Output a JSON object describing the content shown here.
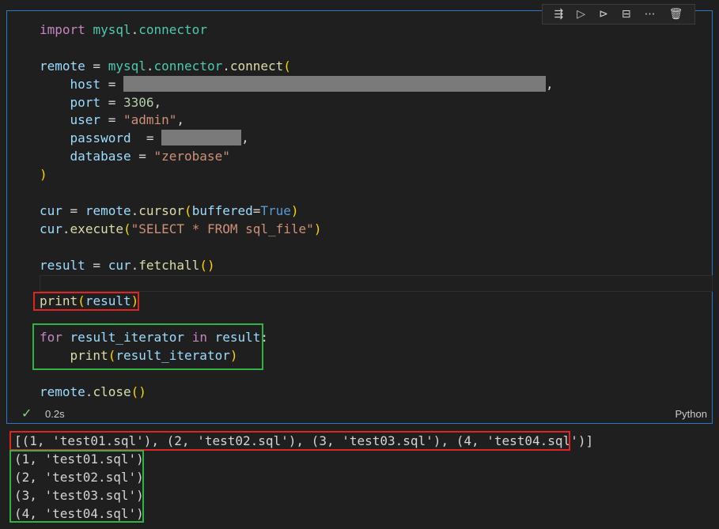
{
  "toolbar": {
    "icons": [
      "execute-above-icon",
      "run-by-line-icon",
      "execute-below-icon",
      "split-cell-icon",
      "more-icon",
      "delete-icon"
    ]
  },
  "code": {
    "l1": {
      "kw": "import",
      "mod": "mysql",
      "dot": ".",
      "sub": "connector"
    },
    "l3": {
      "var": "remote",
      "eq": " = ",
      "mod": "mysql",
      "dot": ".",
      "sub": "connector",
      "dot2": ".",
      "fn": "connect",
      "open": "("
    },
    "l4": {
      "indent": "    ",
      "key": "host",
      "eq": " = ",
      "comma": ","
    },
    "l5": {
      "indent": "    ",
      "key": "port",
      "eq": " = ",
      "val": "3306",
      "comma": ","
    },
    "l6": {
      "indent": "    ",
      "key": "user",
      "eq": " = ",
      "val": "\"admin\"",
      "comma": ","
    },
    "l7": {
      "indent": "    ",
      "key": "password",
      "eq": "  = ",
      "comma": ","
    },
    "l8": {
      "indent": "    ",
      "key": "database",
      "eq": " = ",
      "val": "\"zerobase\""
    },
    "l9": {
      "close": ")"
    },
    "l11": {
      "var": "cur",
      "eq": " = ",
      "obj": "remote",
      "dot": ".",
      "fn": "cursor",
      "open": "(",
      "arg": "buffered",
      "eq2": "=",
      "val": "True",
      "close": ")"
    },
    "l12": {
      "obj": "cur",
      "dot": ".",
      "fn": "execute",
      "open": "(",
      "val": "\"SELECT * FROM sql_file\"",
      "close": ")"
    },
    "l14": {
      "var": "result",
      "eq": " = ",
      "obj": "cur",
      "dot": ".",
      "fn": "fetchall",
      "parens": "()"
    },
    "l16": {
      "fn": "print",
      "open": "(",
      "arg": "result",
      "close": ")"
    },
    "l18": {
      "kw": "for",
      "var": "result_iterator",
      "kw2": "in",
      "obj": "result",
      "colon": ":"
    },
    "l19": {
      "indent": "    ",
      "fn": "print",
      "open": "(",
      "arg": "result_iterator",
      "close": ")"
    },
    "l21": {
      "obj": "remote",
      "dot": ".",
      "fn": "close",
      "parens": "()"
    }
  },
  "status": {
    "check": "✓",
    "time": "0.2s",
    "language": "Python"
  },
  "output": [
    "[(1, 'test01.sql'), (2, 'test02.sql'), (3, 'test03.sql'), (4, 'test04.sql')]",
    "(1, 'test01.sql')",
    "(2, 'test02.sql')",
    "(3, 'test03.sql')",
    "(4, 'test04.sql')"
  ],
  "colors": {
    "accent": "#2b79c2",
    "highlight_red": "#e02424",
    "highlight_green": "#2fb344"
  }
}
